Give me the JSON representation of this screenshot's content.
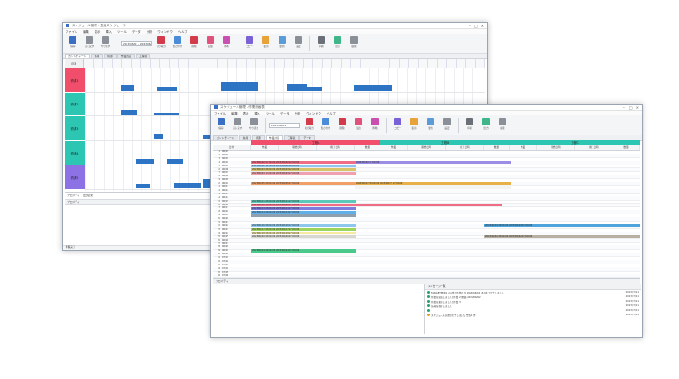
{
  "window1": {
    "title": "スケジュール管理 - 生産スケジューラ",
    "menu": [
      "ファイル",
      "編集",
      "表示",
      "挿入",
      "ツール",
      "データ",
      "分析",
      "ウィンドウ",
      "ヘルプ"
    ],
    "ribbon": [
      "保存",
      "元に戻す",
      "やり直す",
      "切り取り",
      "貼り付け",
      "削除",
      "追加",
      "移動",
      "コピー",
      "表示",
      "更新",
      "設定",
      "印刷",
      "出力",
      "検索"
    ],
    "field": "2023/06/01 - 2023/06/30",
    "tabs": [
      "ガントチャート",
      "負荷",
      "資源",
      "作業計画",
      "工程表"
    ],
    "corner": "資源",
    "resources": [
      {
        "label": "資源1",
        "color": "#f04e6a"
      },
      {
        "label": "資源2",
        "color": "#2dc6b2"
      },
      {
        "label": "資源3",
        "color": "#2dc6b2"
      },
      {
        "label": "資源4",
        "color": "#2dc6b2"
      },
      {
        "label": "資源5",
        "color": "#8d72e6"
      }
    ],
    "bottom_tabs": [
      "プロパティ",
      "出力結果"
    ],
    "bottom_head": "プロパティ",
    "status": "準備完了"
  },
  "window2": {
    "title": "スケジュール管理 - 作業計画表",
    "menu": [
      "ファイル",
      "編集",
      "表示",
      "挿入",
      "ツール",
      "データ",
      "分析",
      "ウィンドウ",
      "ヘルプ"
    ],
    "ribbon": [
      "保存",
      "元に戻す",
      "やり直す",
      "切り取り",
      "貼り付け",
      "削除",
      "追加",
      "移動",
      "コピー",
      "表示",
      "更新",
      "設定",
      "印刷",
      "出力",
      "検索"
    ],
    "field": "2023/06/01",
    "tabs": [
      "ガントチャート",
      "負荷",
      "資源",
      "作業計画",
      "工程表",
      "データ"
    ],
    "groups": [
      {
        "label": "工程A",
        "color": "#f04e6a"
      },
      {
        "label": "工程B",
        "color": "#2dc6b2"
      },
      {
        "label": "工程C",
        "color": "#2dc6b2"
      }
    ],
    "columns": [
      "日付",
      "作業",
      "開始日時",
      "終了日時",
      "数量"
    ],
    "dates": [
      "06/01",
      "06/02",
      "06/03",
      "06/04",
      "06/05",
      "06/06",
      "06/07",
      "06/08",
      "06/09",
      "06/10",
      "06/11",
      "06/12",
      "06/13",
      "06/14",
      "06/15",
      "06/16",
      "06/17",
      "06/18",
      "06/19",
      "06/20",
      "06/21",
      "06/22",
      "06/23",
      "06/24",
      "06/25",
      "06/26",
      "06/27",
      "06/28",
      "06/29",
      "06/30",
      "07/01",
      "07/02",
      "07/03",
      "07/04",
      "07/05",
      "07/06"
    ],
    "bars": [
      {
        "row": 3,
        "text": "2023/06/02 07:00:00  2023/06/02 12:00:00",
        "color": "#f06d86",
        "span": "a"
      },
      {
        "row": 3,
        "text": "2023/06/02 07:00:00",
        "color": "#9a8de6",
        "span": "b"
      },
      {
        "row": 4,
        "text": "2023/06/02 12:00:00  2023/06/02 18:00:00",
        "color": "#8ec7ee",
        "span": "a"
      },
      {
        "row": 5,
        "text": "2023/06/03 08:00:00  2023/06/03 12:00:00",
        "color": "#d9c46a",
        "span": "a"
      },
      {
        "row": 6,
        "text": "2023/06/03 13:00:00  2023/06/03 17:00:00",
        "color": "#f0a0ae",
        "span": "a"
      },
      {
        "row": 9,
        "text": "2023/06/05 08:00:00  2023/06/05 17:00:00",
        "color": "#f0a066",
        "span": "a"
      },
      {
        "row": 9,
        "text": "2023/06/07 08:00:00  2023/06/07 17:00:00",
        "color": "#e8b048",
        "span": "c"
      },
      {
        "row": 10,
        "text": "",
        "color": "#f3f3f3",
        "span": "b"
      },
      {
        "row": 14,
        "text": "2023/06/11 08:00:00  2023/06/11 17:00:00",
        "color": "#5cc9b8",
        "span": "a"
      },
      {
        "row": 15,
        "text": "2023/06/12 08:00:00  2023/06/12 17:00:00",
        "color": "#f06d86",
        "span": "a"
      },
      {
        "row": 15,
        "text": "",
        "color": "#f06d86",
        "span": "d"
      },
      {
        "row": 16,
        "text": "2023/06/13 08:00:00  2023/06/13 17:00:00",
        "color": "#7d7de0",
        "span": "a"
      },
      {
        "row": 17,
        "text": "2023/06/14 08:00:00  2023/06/14 17:00:00",
        "color": "#5fb0e8",
        "span": "a"
      },
      {
        "row": 18,
        "text": "",
        "color": "#8ea0b0",
        "span": "a"
      },
      {
        "row": 21,
        "text": "2023/06/16 08:00:00  2023/06/16 17:00:00",
        "color": "#8ec7ee",
        "span": "a"
      },
      {
        "row": 21,
        "text": "2023/06/19 08:00:00  2023/06/19 17:00:00",
        "color": "#4fa4dc",
        "span": "e"
      },
      {
        "row": 22,
        "text": "2023/06/17 08:00:00  2023/06/17 17:00:00",
        "color": "#9dd45a",
        "span": "a"
      },
      {
        "row": 23,
        "text": "2023/06/18 08:00:00  2023/06/18 17:00:00",
        "color": "#f7e9a0",
        "span": "a"
      },
      {
        "row": 24,
        "text": "2023/06/20 08:00:00  2023/06/20 17:00:00",
        "color": "#d8d8d0",
        "span": "a"
      },
      {
        "row": 24,
        "text": "2023/06/22 08:00:00  2023/06/22 17:00:00",
        "color": "#b8b0a0",
        "span": "e"
      },
      {
        "row": 28,
        "text": "2023/06/24 08:00:00  2023/06/24 17:00:00",
        "color": "#4bc98a",
        "span": "a"
      }
    ],
    "bottom_head": "プロパティ",
    "log_head": "メッセージ一覧",
    "log": [
      {
        "text": "TARGET 資源1 の作業 [作業1] が 2023/06/01 15:00 で完了しました",
        "date": "2023/07/11"
      },
      {
        "text": "作業を追加しました [作業 2] 開始 2023/06/02",
        "date": "2023/07/11"
      },
      {
        "text": "作業を更新しました [作業 3]",
        "date": "2023/07/11"
      },
      {
        "text": "計画を保存しました",
        "date": "2023/07/11"
      },
      {
        "text": "",
        "date": "2023/07/11"
      },
      {
        "text": "スケジュール計算が完了しました 警告 1 件",
        "date": "2023/07/11"
      }
    ]
  }
}
